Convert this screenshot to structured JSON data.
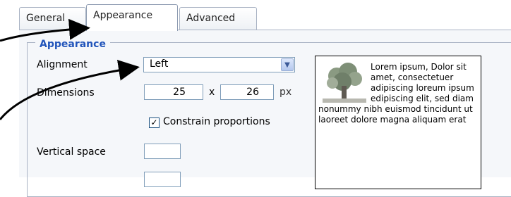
{
  "tabs": [
    {
      "label": "General",
      "active": false
    },
    {
      "label": "Appearance",
      "active": true
    },
    {
      "label": "Advanced",
      "active": false
    }
  ],
  "appearance": {
    "legend": "Appearance",
    "alignment_label": "Alignment",
    "alignment_value": "Left",
    "dimensions_label": "Dimensions",
    "width_value": "25",
    "times_symbol": "x",
    "height_value": "26",
    "unit": "px",
    "constrain_label": "Constrain proportions",
    "constrain_checked": true,
    "check_mark": "✓",
    "vertical_space_label": "Vertical space",
    "vertical_space_value": "",
    "horizontal_space_value": ""
  },
  "preview": {
    "text": "Lorem ipsum, Dolor sit amet, consectetuer adipiscing loreum ipsum edipiscing elit, sed diam nonummy nibh euismod tincidunt ut laoreet dolore magna aliquam erat"
  },
  "icons": {
    "dropdown": "chevron-down-icon",
    "preview": "tree-image-icon"
  },
  "colors": {
    "legend": "#2255bb",
    "border": "#a9b3c4",
    "panel_bg": "#f5f7fa"
  }
}
